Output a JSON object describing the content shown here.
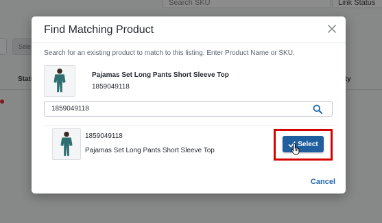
{
  "background": {
    "search_placeholder": "Search SKU",
    "link_status_label": "Link Status",
    "select_button_partial": "Sele",
    "status_header_partial": "Statu",
    "quantity_header_partial": "ity"
  },
  "modal": {
    "title": "Find Matching Product",
    "instructions": "Search for an existing product to match to this listing. Enter Product Name or SKU.",
    "listing": {
      "name": "Pajamas Set Long Pants Short Sleeve Top",
      "sku": "1859049118"
    },
    "search": {
      "value": "1859049118",
      "placeholder": ""
    },
    "results": [
      {
        "sku": "1859049118",
        "name": "Pajamas Set Long Pants Short Sleeve Top",
        "select_label": "Select"
      }
    ],
    "cancel_label": "Cancel"
  },
  "colors": {
    "primary_button": "#1f5f9f",
    "highlight_border": "#d50000",
    "link": "#1f66b0",
    "product_teal": "#2e6e70"
  },
  "icons": [
    "close-icon",
    "search-icon",
    "check-icon",
    "hand-cursor-icon"
  ]
}
